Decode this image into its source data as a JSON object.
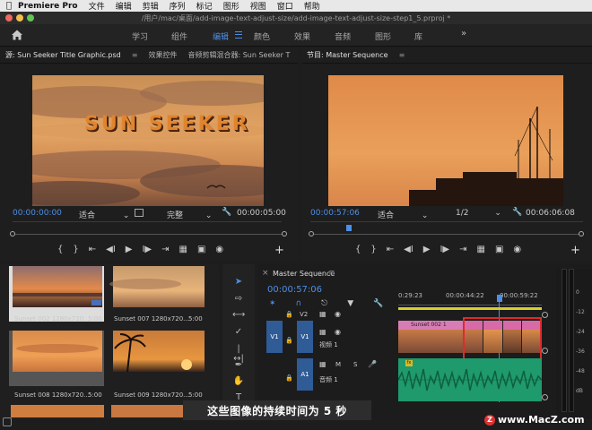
{
  "menubar": {
    "app_name": "Premiere Pro",
    "items": [
      "文件",
      "编辑",
      "剪辑",
      "序列",
      "标记",
      "图形",
      "视图",
      "窗口",
      "帮助"
    ]
  },
  "titlebar": {
    "path": "/用户/mac/桌面/add-image-text-adjust-size/add-image-text-adjust-size-step1_5.prproj *"
  },
  "workspace": {
    "tabs": [
      "学习",
      "组件",
      "编辑",
      "颜色",
      "效果",
      "音频",
      "图形",
      "库"
    ],
    "active_tab": "编辑"
  },
  "source_monitor": {
    "tabs": [
      "源: Sun Seeker Title Graphic.psd",
      "效果控件",
      "音频剪辑混合器: Sun Seeker T"
    ],
    "title_text": "SUN SEEKER",
    "timecode_in": "00:00:00:00",
    "fit": "适合",
    "quality": "完整",
    "duration": "00:00:05:00"
  },
  "program_monitor": {
    "tab": "节目: Master Sequence",
    "timecode_in": "00:00:57:06",
    "fit": "适合",
    "resolution": "1/2",
    "duration": "00:06:06:08"
  },
  "project_bin": {
    "clips": [
      {
        "name": "Sunset 002 1280x720...",
        "duration": "5:00"
      },
      {
        "name": "Sunset 007 1280x720...",
        "duration": "5:00"
      },
      {
        "name": "Sunset 008 1280x720...",
        "duration": "5:00"
      },
      {
        "name": "Sunset 009 1280x720...",
        "duration": "5:00"
      }
    ]
  },
  "timeline": {
    "tab": "Master Sequence",
    "timecode": "00:00:57:06",
    "ruler_labels": [
      "0:29:23",
      "00:00:44:22",
      "00:00:59:22"
    ],
    "tracks": {
      "v2": "V2",
      "v1_src": "V1",
      "v1": "V1",
      "v1_name": "视频 1",
      "a1_src": "A1",
      "a1": "A1",
      "a1_name": "音频 1",
      "m": "M",
      "s": "S"
    },
    "clip_label": "Sunset 002 1",
    "fx": "fx",
    "meter_ticks": [
      "0",
      "-12",
      "-24",
      "-36",
      "-48",
      "dB"
    ]
  },
  "subtitle": "这些图像的持续时间为 5 秒",
  "watermark": "www.MacZ.com",
  "watermark_logo": "Z"
}
